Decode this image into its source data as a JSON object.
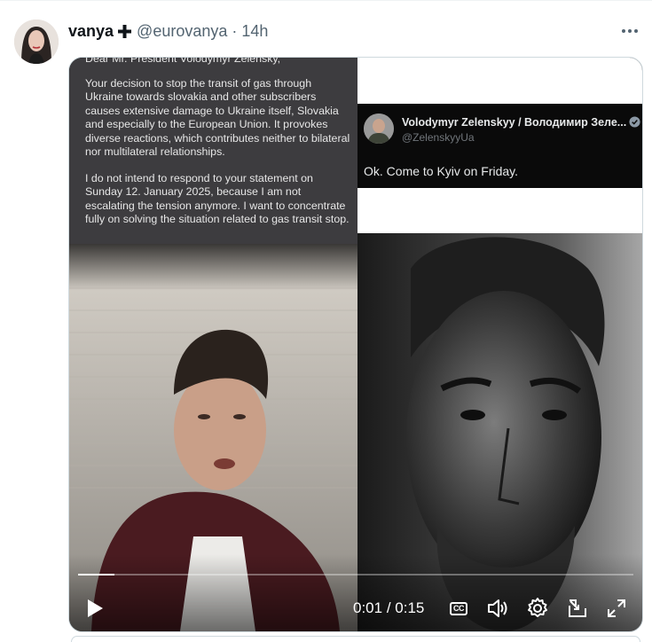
{
  "tweet": {
    "display_name": "vanya",
    "handle": "@eurovanya",
    "separator": "·",
    "time": "14h"
  },
  "media": {
    "letter": {
      "greeting": "Dear Mr. President Volodymyr Zelensky,",
      "paragraph1": "Your decision to stop the transit of gas through Ukraine towards slovakia and other subscribers causes extensive damage to Ukraine itself, Slovakia and especially to the European Union. It provokes diverse reactions, which contributes neither to bilateral nor multilateral relationships.",
      "paragraph2": "I do not intend to respond to your statement on Sunday 12. January 2025, because I am not escalating the tension anymore. I want to concentrate fully on solving the situation related to gas transit stop."
    },
    "quote": {
      "name": "Volodymyr Zelenskyy / Володимир Зеле...",
      "handle": "@ZelenskyyUa",
      "text": "Ok. Come to Kyiv on Friday."
    },
    "player": {
      "current_time": "0:01",
      "time_separator": " / ",
      "duration": "0:15",
      "progress_fraction": 0.066,
      "cc_label": "CC"
    }
  }
}
